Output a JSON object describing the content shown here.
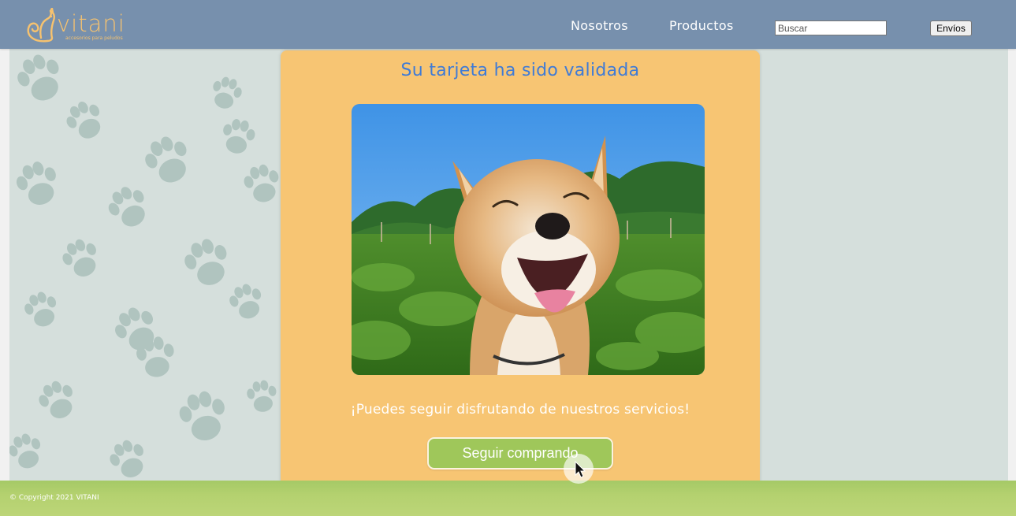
{
  "header": {
    "logo_text": "vitani",
    "logo_tagline": "accesorios para peludos",
    "nav": [
      {
        "label": "Nosotros"
      },
      {
        "label": "Productos"
      }
    ],
    "search": {
      "placeholder": "Buscar",
      "value": ""
    },
    "shipping_label": "Envíos"
  },
  "card": {
    "title": "Su tarjeta ha sido validada",
    "message": "¡Puedes seguir disfrutando de nuestros servicios!",
    "button_label": "Seguir comprando"
  },
  "footer": {
    "copyright": "© Copyright 2021 VITANI"
  },
  "colors": {
    "header_bg": "#7790ad",
    "logo": "#f6c26f",
    "card_bg": "#f7c573",
    "title": "#3f7bd6",
    "button_bg": "#9fc75a",
    "footer_bg": "#b4d16f"
  },
  "icons": [
    "squirrel-logo-icon",
    "paw-print-icon",
    "mouse-pointer-icon"
  ]
}
